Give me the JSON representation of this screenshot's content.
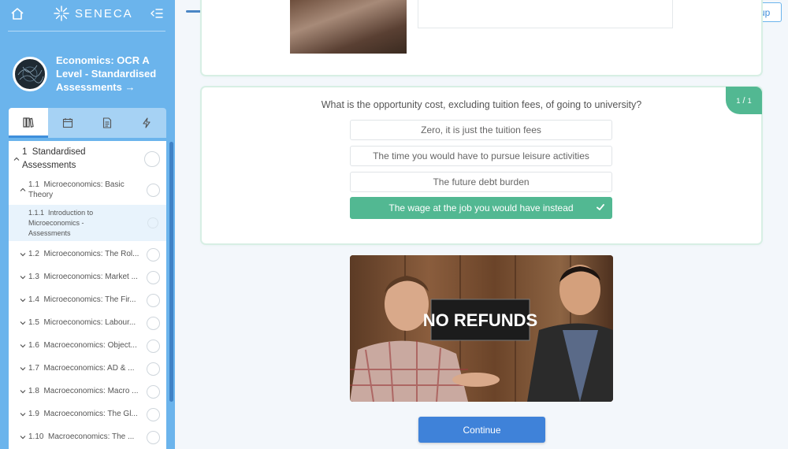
{
  "header": {
    "logo_text": "SENECA",
    "signup_label": "Sign up",
    "progress": 0.51,
    "language_flag": "uk-flag-icon"
  },
  "sidebar": {
    "course_title": "Economics: OCR A Level - Standardised Assessments →",
    "tabs": [
      "books-icon",
      "calendar-icon",
      "document-icon",
      "lightning-icon"
    ],
    "outline": [
      {
        "level": 0,
        "num": "1",
        "label": "Standardised Assessments",
        "expanded": true
      },
      {
        "level": 1,
        "num": "1.1",
        "label": "Microeconomics: Basic Theory",
        "expanded": true
      },
      {
        "level": 2,
        "num": "1.1.1",
        "label": "Introduction to Microeconomics - Assessments",
        "selected": true
      },
      {
        "level": 1,
        "num": "1.2",
        "label": "Microeconomics: The Rol..."
      },
      {
        "level": 1,
        "num": "1.3",
        "label": "Microeconomics: Market ..."
      },
      {
        "level": 1,
        "num": "1.4",
        "label": "Microeconomics: The Fir..."
      },
      {
        "level": 1,
        "num": "1.5",
        "label": "Microeconomics: Labour..."
      },
      {
        "level": 1,
        "num": "1.6",
        "label": "Macroeconomics: Object..."
      },
      {
        "level": 1,
        "num": "1.7",
        "label": "Macroeconomics: AD & ..."
      },
      {
        "level": 1,
        "num": "1.8",
        "label": "Macroeconomics: Macro ..."
      },
      {
        "level": 1,
        "num": "1.9",
        "label": "Macroeconomics: The Gl..."
      },
      {
        "level": 1,
        "num": "1.10",
        "label": "Macroeconomics: The ..."
      }
    ]
  },
  "question": {
    "text": "What is the opportunity cost, excluding tuition fees, of going to university?",
    "badge_num": "1",
    "badge_den": "1",
    "options": [
      {
        "label": "Zero, it is just the tuition fees",
        "correct": false
      },
      {
        "label": "The time you would have to pursue leisure activities",
        "correct": false
      },
      {
        "label": "The future debt burden",
        "correct": false
      },
      {
        "label": "The wage at the job you would have instead",
        "correct": true
      }
    ]
  },
  "gif": {
    "sign_text": "NO REFUNDS"
  },
  "continue_label": "Continue",
  "colors": {
    "sidebar": "#6bb4ec",
    "correct": "#52b892",
    "primary": "#3f82d9"
  }
}
